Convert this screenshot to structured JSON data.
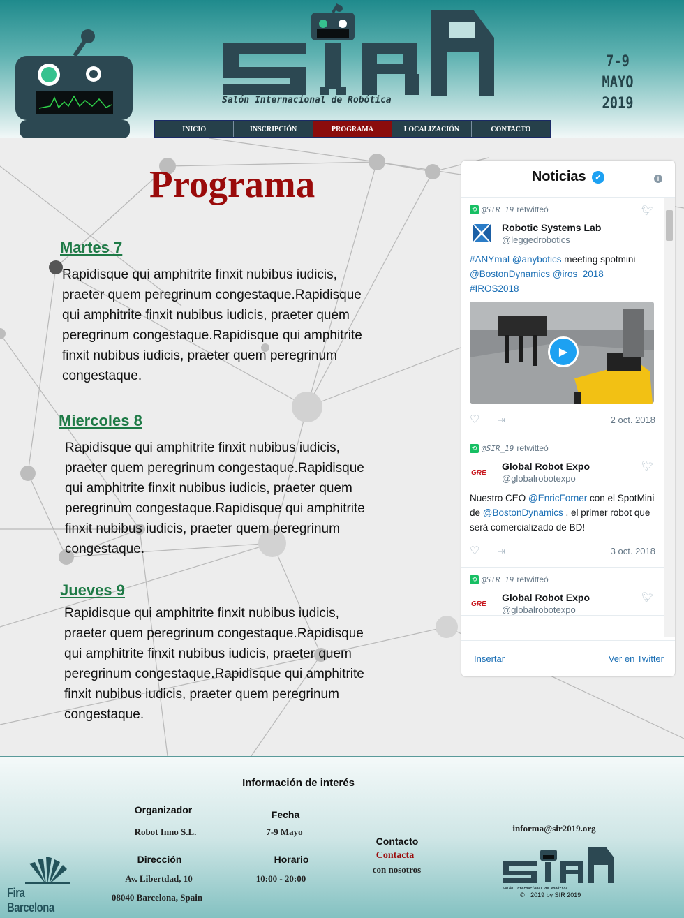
{
  "header": {
    "logo_text": "SIR",
    "subtitle": "Salón Internacional de Robótica",
    "date_range": "7-9",
    "date_month": "MAYO 2019"
  },
  "nav": {
    "items": [
      "INICIO",
      "INSCRIPCIÓN",
      "PROGRAMA",
      "LOCALIZACIÓN",
      "CONTACTO"
    ],
    "active": "PROGRAMA"
  },
  "main": {
    "title": "Programa",
    "days": [
      {
        "label": "Martes 7",
        "text": "Rapidisque qui amphitrite finxit nubibus iudicis, praeter quem peregrinum congestaque.Rapidisque qui amphitrite finxit nubibus iudicis, praeter quem peregrinum congestaque.Rapidisque qui amphitrite finxit nubibus iudicis, praeter quem peregrinum congestaque."
      },
      {
        "label": "Miercoles 8",
        "text": "Rapidisque qui amphitrite finxit nubibus iudicis, praeter quem peregrinum congestaque.Rapidisque qui amphitrite finxit nubibus iudicis, praeter quem peregrinum congestaque.Rapidisque qui amphitrite finxit nubibus iudicis, praeter quem peregrinum congestaque."
      },
      {
        "label": "Jueves 9",
        "text": "Rapidisque qui amphitrite finxit nubibus iudicis, praeter quem peregrinum congestaque.Rapidisque qui amphitrite finxit nubibus iudicis, praeter quem peregrinum congestaque.Rapidisque qui amphitrite finxit nubibus iudicis, praeter quem peregrinum congestaque."
      }
    ]
  },
  "widget": {
    "title": "Noticias",
    "info": "i",
    "tweets": [
      {
        "retweeter": "@SIR_19",
        "rt_label": "retwitteó",
        "name": "Robotic Systems Lab",
        "handle": "@leggedrobotics",
        "text_parts": [
          "#ANYmal",
          " ",
          "@anybotics",
          " meeting spotmini ",
          "@BostonDynamics",
          " ",
          "@iros_2018",
          " ",
          "#IROS2018"
        ],
        "date": "2 oct. 2018"
      },
      {
        "retweeter": "@SIR_19",
        "rt_label": "retwitteó",
        "name": "Global Robot Expo",
        "handle": "@globalrobotexpo",
        "text_parts": [
          "Nuestro CEO ",
          "@EnricForner",
          " con el SpotMini de ",
          "@BostonDynamics",
          " , el primer robot que será comercializado de BD!"
        ],
        "date": "3 oct. 2018"
      },
      {
        "retweeter": "@SIR_19",
        "rt_label": "retwitteó",
        "name": "Global Robot Expo",
        "handle": "@globalrobotexpo"
      }
    ],
    "insert_label": "Insertar",
    "view_label": "Ver en Twitter"
  },
  "footer": {
    "heading": "Información de interés",
    "organizer_label": "Organizador",
    "organizer_value": "Robot Inno S.L.",
    "date_label": "Fecha",
    "date_value": "7-9 Mayo",
    "address_label": "Dirección",
    "address_line1": "Av. Libertdad, 10",
    "address_line2": "08040 Barcelona, Spain",
    "hours_label": "Horario",
    "hours_value": "10:00 - 20:00",
    "contact_label": "Contacto",
    "contact_link": "Contacta",
    "contact_rest": "con nosotros",
    "email": "informa@sir2019.org",
    "fira_text": "Fira Barcelona",
    "copyright": "2019 by SIR 2019",
    "copyright_symbol": "©",
    "small_logo_sub": "Salón Internacional de Robótica"
  },
  "colors": {
    "accent_red": "#9a0b0b",
    "day_green": "#1e7a46",
    "nav_bg": "#26404a",
    "teal": "#1f8a8c"
  }
}
